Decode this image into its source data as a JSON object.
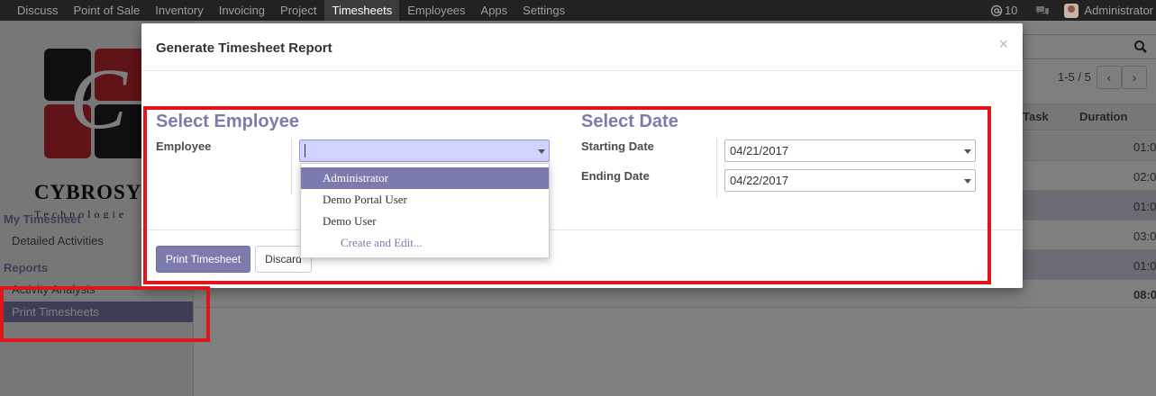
{
  "navbar": {
    "menu": [
      "Discuss",
      "Point of Sale",
      "Inventory",
      "Invoicing",
      "Project",
      "Timesheets",
      "Employees",
      "Apps",
      "Settings"
    ],
    "active": "Timesheets",
    "mentions_count": "10",
    "user_name": "Administrator"
  },
  "sidebar": {
    "logo_name": "CYBROSY",
    "logo_tagline": "Technologie",
    "section1": "My Timesheet",
    "item_detailed": "Detailed Activities",
    "section2": "Reports",
    "item_activity": "Activity Analysis",
    "item_print": "Print Timesheets"
  },
  "list": {
    "pager": "1-5 / 5",
    "columns": {
      "task": "Task",
      "duration": "Duration"
    },
    "rows": [
      "01:0",
      "02:0",
      "01:0",
      "03:0",
      "01:0"
    ],
    "total": "08:0"
  },
  "modal": {
    "title": "Generate Timesheet Report",
    "close": "×",
    "employee_section": "Select Employee",
    "employee_label": "Employee",
    "employee_value": "",
    "date_section": "Select Date",
    "start_label": "Starting Date",
    "start_value": "04/21/2017",
    "end_label": "Ending Date",
    "end_value": "04/22/2017",
    "print_button": "Print Timesheet",
    "discard_button": "Discard"
  },
  "dropdown": {
    "options": [
      "Administrator",
      "Demo Portal User",
      "Demo User"
    ],
    "create_edit": "Create and Edit..."
  },
  "colors": {
    "accent": "#7c7bad",
    "navbar": "#222222",
    "annotation": "#e0141b"
  },
  "icons": [
    "at-icon",
    "chat-icon",
    "avatar",
    "search-icon",
    "chevron-left-icon",
    "chevron-right-icon",
    "caret-down-icon",
    "close-icon"
  ]
}
